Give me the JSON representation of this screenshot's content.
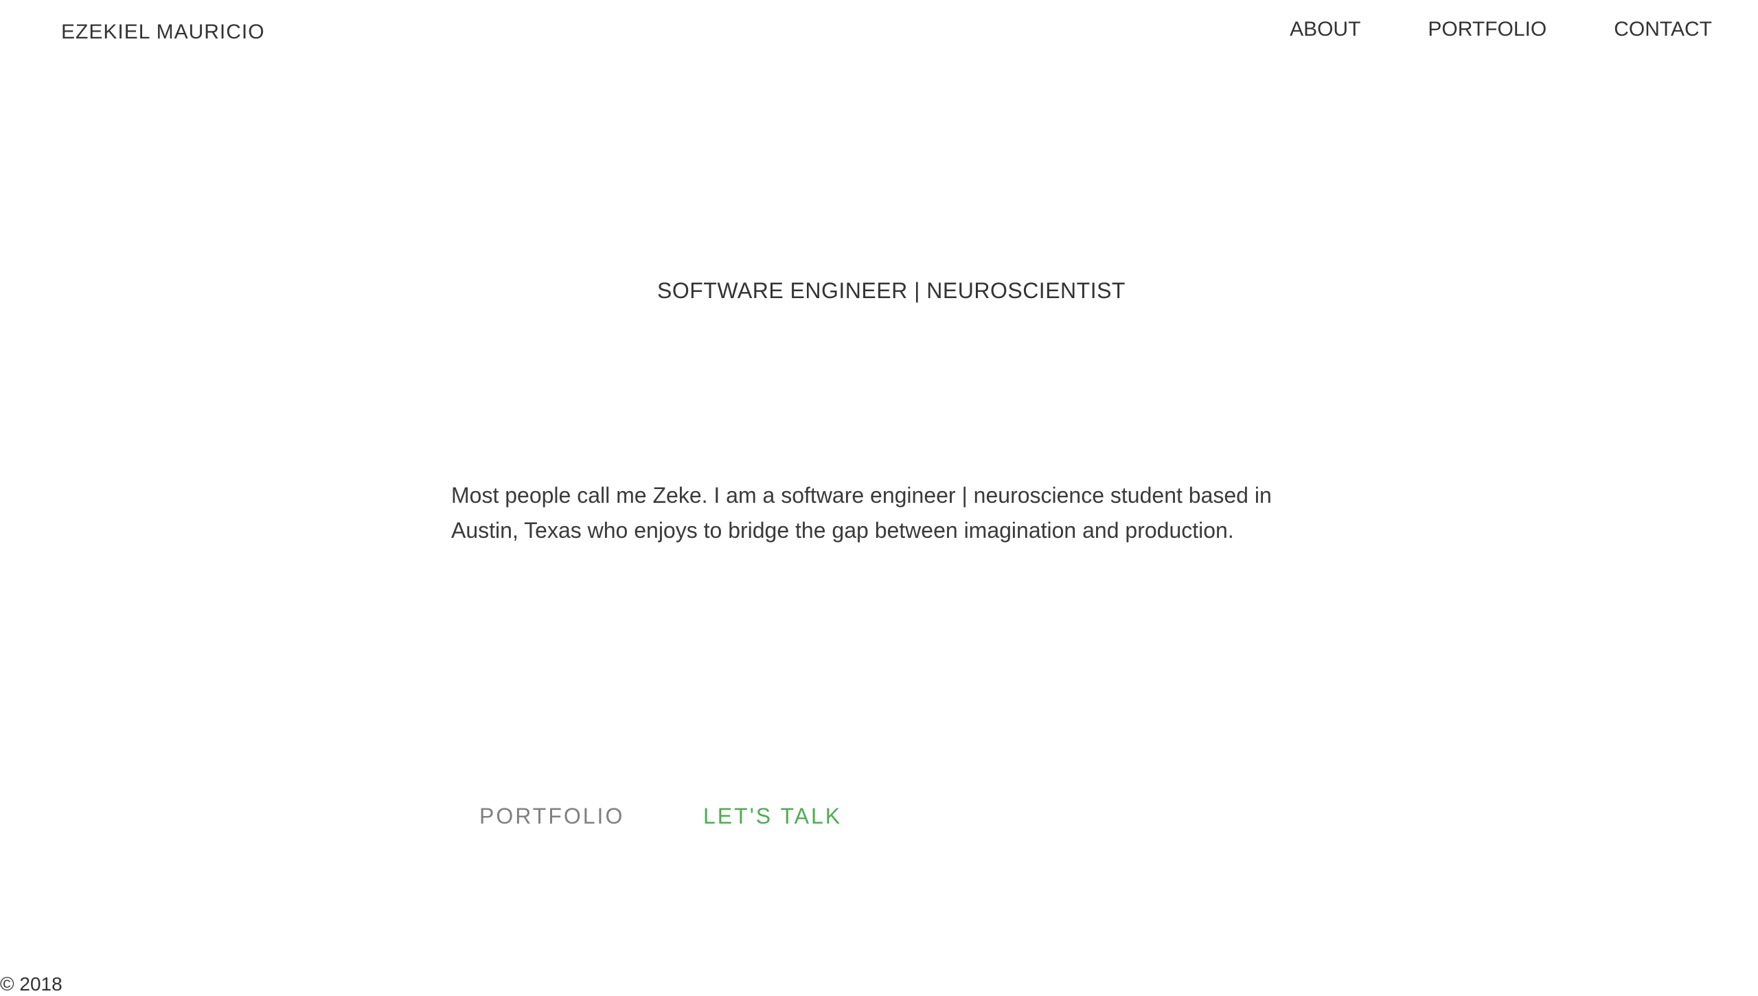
{
  "brand": {
    "name": "EZEKIEL MAURICIO"
  },
  "nav": {
    "items": [
      {
        "label": "ABOUT"
      },
      {
        "label": "PORTFOLIO"
      },
      {
        "label": "CONTACT"
      }
    ]
  },
  "hero": {
    "headline": "SOFTWARE ENGINEER | NEUROSCIENTIST",
    "intro": "Most people call me Zeke. I am a software engineer | neuroscience student based in Austin, Texas who enjoys to bridge the gap between imagination and production."
  },
  "cta": {
    "portfolio_label": "PORTFOLIO",
    "talk_label": "LET'S TALK"
  },
  "footer": {
    "copyright": "© 2018"
  },
  "colors": {
    "text": "#333333",
    "muted": "#808080",
    "accent_green": "#4caf50",
    "background": "#ffffff"
  }
}
